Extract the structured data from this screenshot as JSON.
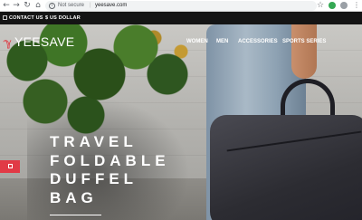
{
  "browser": {
    "security_label": "Not secure",
    "separator": "|",
    "url": "yeesave.com"
  },
  "top_bar": {
    "contact_label": "CONTACT US",
    "currency_label": "$ US DOLLAR"
  },
  "site": {
    "logo_text": "YEESAVE",
    "nav": [
      {
        "label": "WOMEN"
      },
      {
        "label": "MEN"
      },
      {
        "label": "ACCESSORIES"
      },
      {
        "label": "SPORTS SERIES"
      }
    ]
  },
  "hero": {
    "headline_lines": [
      "TRAVEL",
      "FOLDABLE",
      "DUFFEL",
      "BAG"
    ]
  },
  "colors": {
    "accent": "#e13a46",
    "top_bar_bg": "#141414"
  }
}
